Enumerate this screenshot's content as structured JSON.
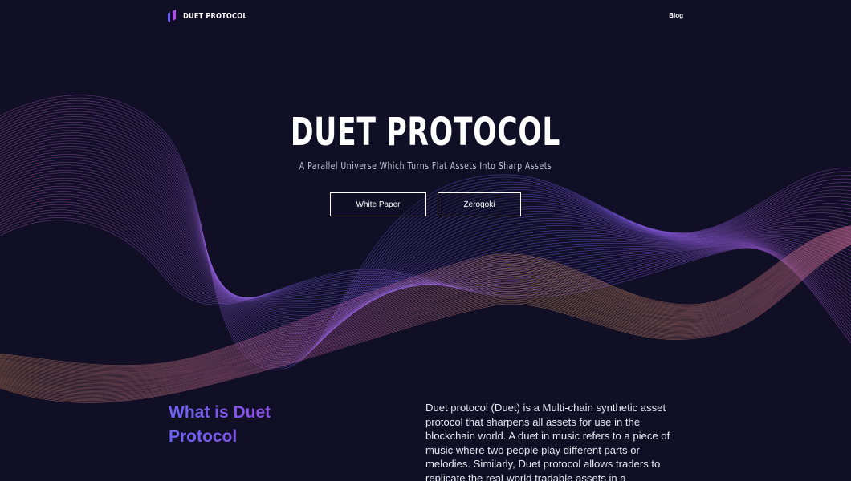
{
  "brand": {
    "name": "DUET PROTOCOL",
    "mark_colors": [
      "#6a5cff",
      "#b14cf0"
    ]
  },
  "nav": {
    "blog_label": "Blog"
  },
  "hero": {
    "title": "DUET PROTOCOL",
    "subtitle": "A Parallel Universe Which Turns Flat Assets Into Sharp Assets",
    "buttons": [
      {
        "label": "White Paper"
      },
      {
        "label": "Zerogoki"
      }
    ]
  },
  "about": {
    "title": "What is Duet Protocol",
    "text": "Duet protocol (Duet) is a Multi-chain synthetic asset protocol that sharpens all assets for use in the blockchain world. A duet in music refers to a piece of music where two people play different parts or melodies. Similarly, Duet protocol allows traders to replicate the real-world tradable assets in a decentralised finance ecosystem."
  },
  "colors": {
    "background": "#100f26",
    "accent_purple": "#8a52e8",
    "accent_blue": "#6b63f2",
    "wave_pink": "#d65fc4",
    "wave_orange": "#e89a5a"
  }
}
